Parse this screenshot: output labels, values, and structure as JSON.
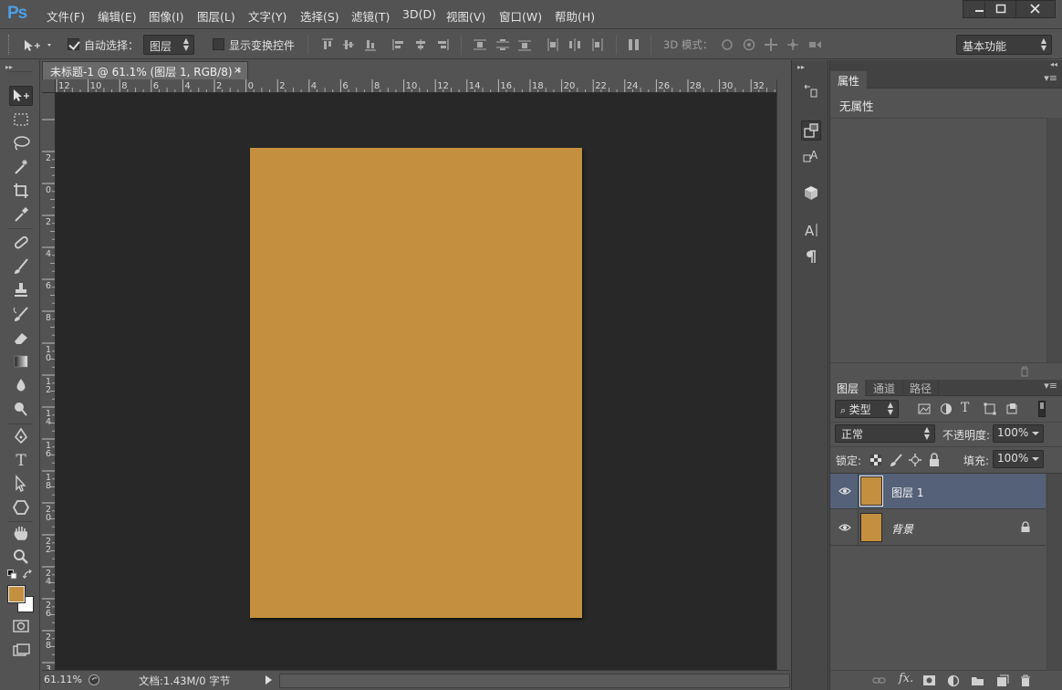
{
  "app": {
    "logo": "Ps"
  },
  "menu": [
    "文件(F)",
    "编辑(E)",
    "图像(I)",
    "图层(L)",
    "文字(Y)",
    "选择(S)",
    "滤镜(T)",
    "3D(D)",
    "视图(V)",
    "窗口(W)",
    "帮助(H)"
  ],
  "options": {
    "auto_select_label": "自动选择：",
    "auto_select_checked": true,
    "auto_select_value": "图层",
    "show_transform_label": "显示变换控件",
    "show_transform_checked": false,
    "mode_3d_label": "3D 模式：",
    "workspace": "基本功能"
  },
  "document": {
    "tab_title": "未标题-1 @ 61.1% (图层 1, RGB/8) *",
    "close_glyph": "×",
    "zoom": "61.11%",
    "doc_info": "文档:1.43M/0 字节",
    "canvas_color": "#c48f3e"
  },
  "ruler": {
    "h_labels": [
      "12",
      "10",
      "8",
      "6",
      "4",
      "2",
      "0",
      "2",
      "4",
      "6",
      "8",
      "10",
      "12",
      "14",
      "16",
      "18",
      "20",
      "22",
      "24",
      "26",
      "28",
      "30",
      "32"
    ],
    "v_labels": [
      "2",
      "0",
      "2",
      "4",
      "6",
      "8",
      "10",
      "12",
      "14",
      "16",
      "18",
      "20",
      "22",
      "24",
      "26",
      "28",
      "30",
      "32"
    ]
  },
  "colors": {
    "foreground": "#c48f3e",
    "background": "#ffffff",
    "accent_selected": "#546178"
  },
  "properties_panel": {
    "tab": "属性",
    "message": "无属性"
  },
  "layers_panel": {
    "tabs": [
      "图层",
      "通道",
      "路径"
    ],
    "filter_kind": "类型",
    "blend_mode": "正常",
    "opacity_label": "不透明度:",
    "opacity_value": "100%",
    "lock_label": "锁定:",
    "fill_label": "填充:",
    "fill_value": "100%",
    "layers": [
      {
        "name": "图层 1",
        "selected": true,
        "locked": false
      },
      {
        "name": "背景",
        "selected": false,
        "locked": true
      }
    ],
    "fx_label": "fx."
  }
}
